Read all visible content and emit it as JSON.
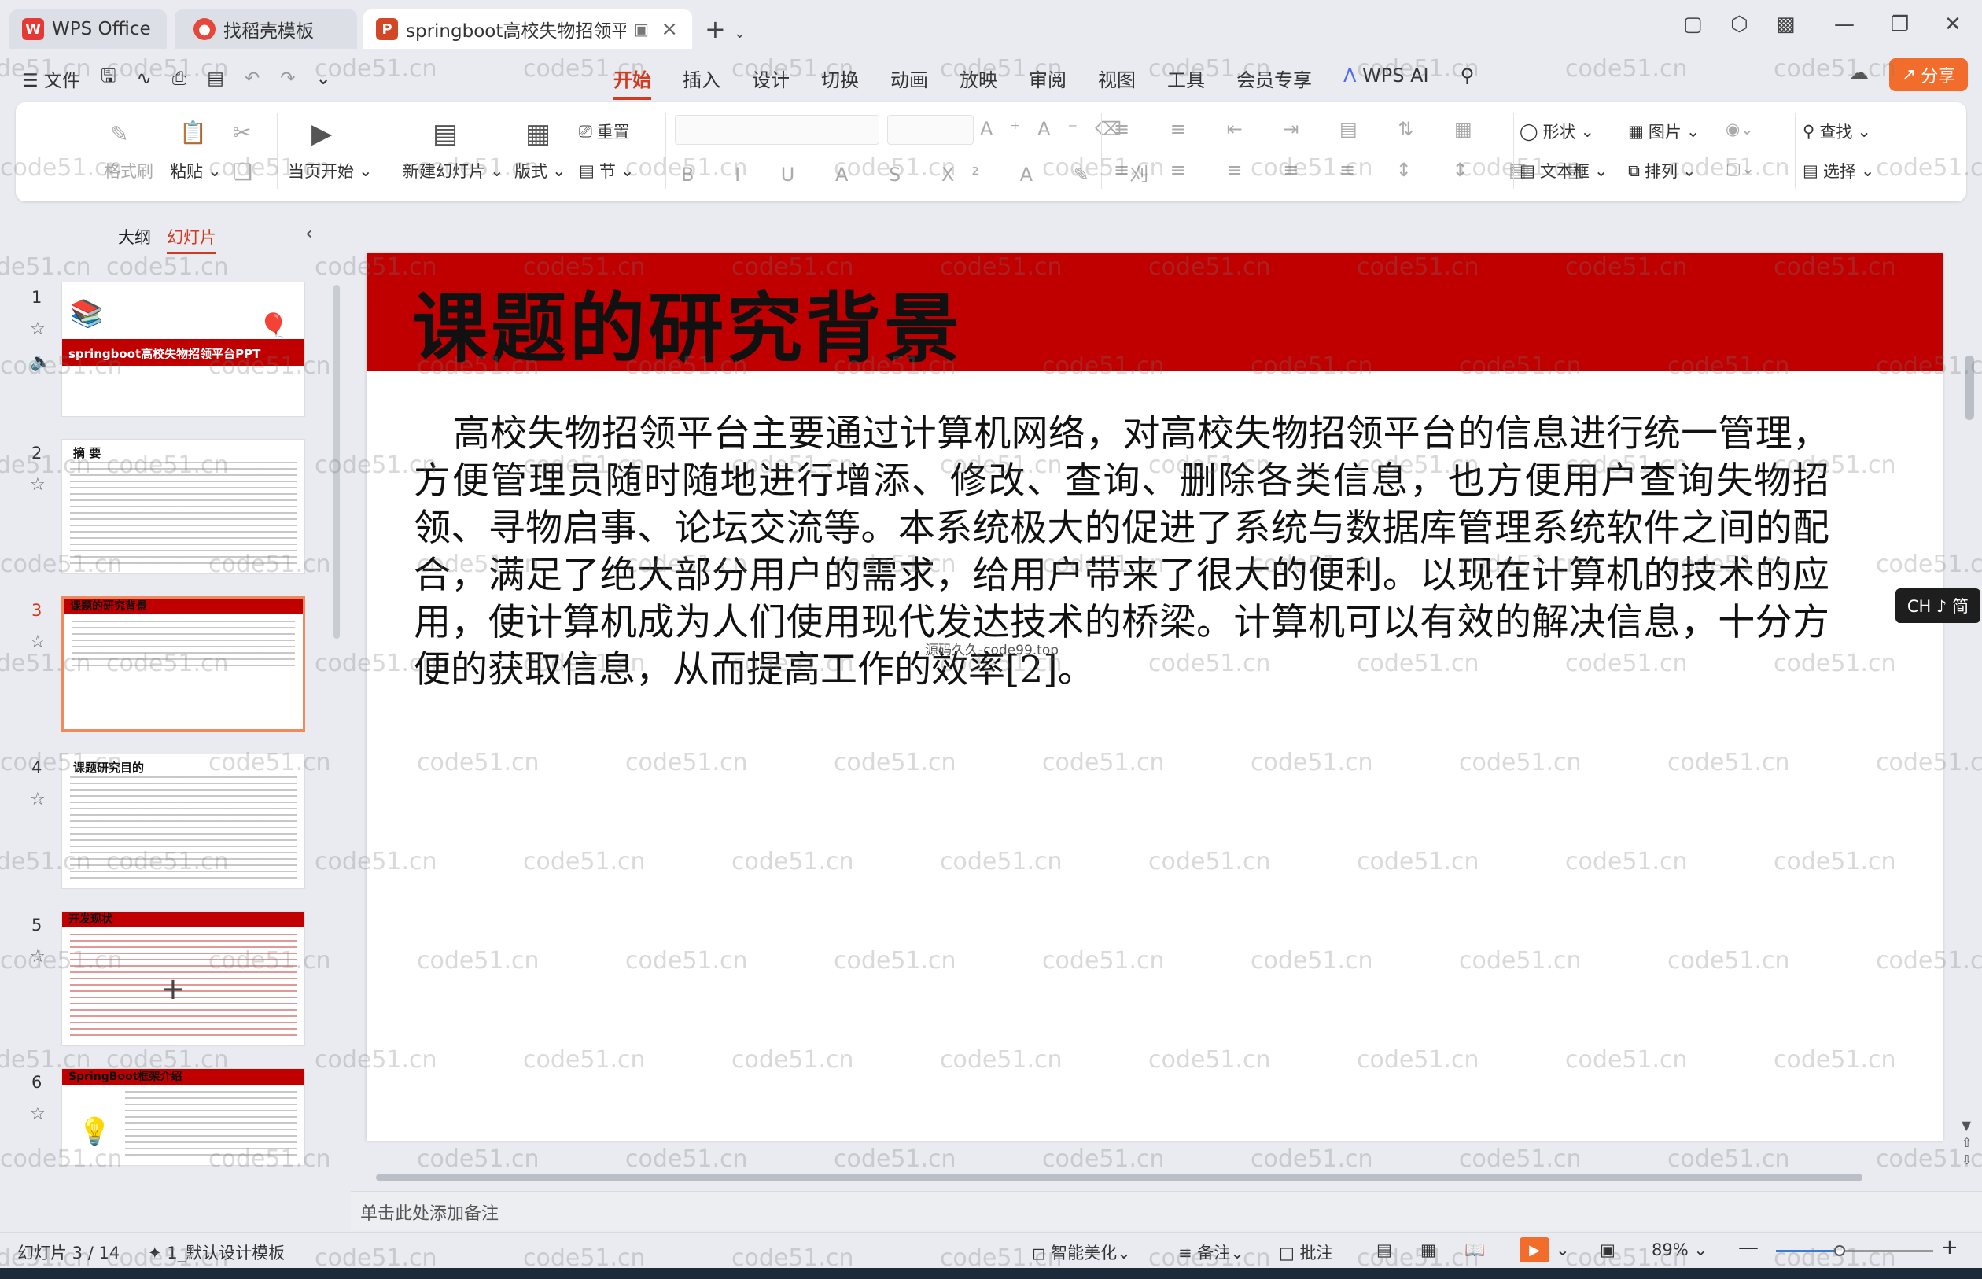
{
  "tabs": {
    "wps": "WPS Office",
    "template": "找稻壳模板",
    "document": "springboot高校失物招领平台"
  },
  "menu": {
    "file": "文件",
    "tabs": [
      "开始",
      "插入",
      "设计",
      "切换",
      "动画",
      "放映",
      "审阅",
      "视图",
      "工具",
      "会员专享"
    ],
    "active_tab": "开始",
    "wps_ai": "WPS AI",
    "share": "分享"
  },
  "ribbon": {
    "format_painter": "格式刷",
    "paste": "粘贴",
    "from_current": "当页开始",
    "new_slide": "新建幻灯片",
    "layout": "版式",
    "reset": "重置",
    "section": "节",
    "shape": "形状",
    "picture": "图片",
    "find": "查找",
    "textbox": "文本框",
    "arrange": "排列",
    "select": "选择"
  },
  "left_panel": {
    "outline_tab": "大纲",
    "slides_tab": "幻灯片",
    "thumbs": [
      {
        "num": "1",
        "title": "springboot高校失物招领平台PPT"
      },
      {
        "num": "2",
        "title": "摘  要"
      },
      {
        "num": "3",
        "title": "课题的研究背景"
      },
      {
        "num": "4",
        "title": "课题研究目的"
      },
      {
        "num": "5",
        "title": "开发现状"
      },
      {
        "num": "6",
        "title": "SpringBoot框架介绍"
      }
    ],
    "current": "3"
  },
  "slide": {
    "title": "课题的研究背景",
    "body": "高校失物招领平台主要通过计算机网络，对高校失物招领平台的信息进行统一管理，方便管理员随时随地进行增添、修改、查询、删除各类信息，也方便用户查询失物招领、寻物启事、论坛交流等。本系统极大的促进了系统与数据库管理系统软件之间的配合，满足了绝大部分用户的需求，给用户带来了很大的便利。以现在计算机的技术的应用，使计算机成为人们使用现代发达技术的桥梁。计算机可以有效的解决信息，十分方便的获取信息，从而提高工作的效率[2]。",
    "watermark": "源码久久-code99.top"
  },
  "notes_placeholder": "单击此处添加备注",
  "ime": "CH ♪ 简",
  "status": {
    "slide_counter": "幻灯片 3 / 14",
    "theme": "1_默认设计模板",
    "beautify": "智能美化",
    "notes": "备注",
    "comments": "批注",
    "zoom": "89%"
  },
  "watermark_text": "code51.cn"
}
